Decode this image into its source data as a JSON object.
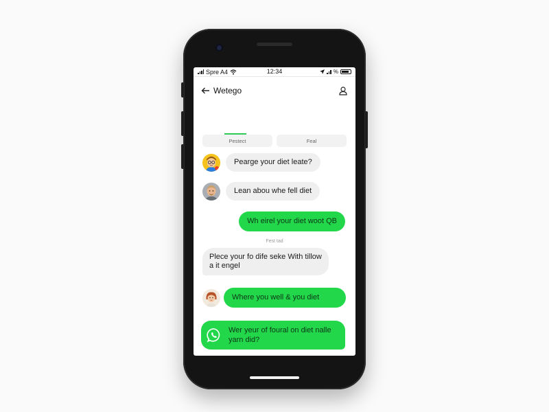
{
  "status_bar": {
    "carrier": "Spre A4",
    "time": "12:34",
    "battery_text": "%"
  },
  "header": {
    "title": "Wetego",
    "back_icon": "arrow-left-icon",
    "profile_icon": "person-icon"
  },
  "tabs": [
    {
      "label": "Pestect",
      "active": true
    },
    {
      "label": "Feal",
      "active": false
    }
  ],
  "messages": [
    {
      "text": "Pearge your diet leate?",
      "side": "left",
      "color": "grey",
      "avatar": "avatar-glasses-man"
    },
    {
      "text": "Lean abou whe fell diet",
      "side": "left",
      "color": "grey",
      "avatar": "avatar-older-man"
    },
    {
      "text": "Wh eirel your diet woot QB",
      "side": "right",
      "color": "green"
    },
    {
      "divider": "Fest tad"
    },
    {
      "text": "Plece your fo dife seke With tillow a it engel",
      "side": "left",
      "color": "grey"
    },
    {
      "text": "Where you well & you diet",
      "side": "left",
      "color": "green",
      "avatar": "avatar-woman"
    },
    {
      "text": "Wer yeur of foural on diet nalle yarn did?",
      "side": "left",
      "color": "green",
      "icon": "whatsapp-icon"
    }
  ],
  "bottom_nav": [
    {
      "icon": "triangle-left-icon"
    },
    {
      "icon": "arrow-right-icon"
    },
    {
      "icon": "box-icon"
    },
    {
      "icon": "bookmark-icon"
    },
    {
      "icon": "share-icon"
    }
  ],
  "colors": {
    "accent": "#22d84a",
    "grey_bubble": "#efefef",
    "phone_body": "#141414"
  }
}
